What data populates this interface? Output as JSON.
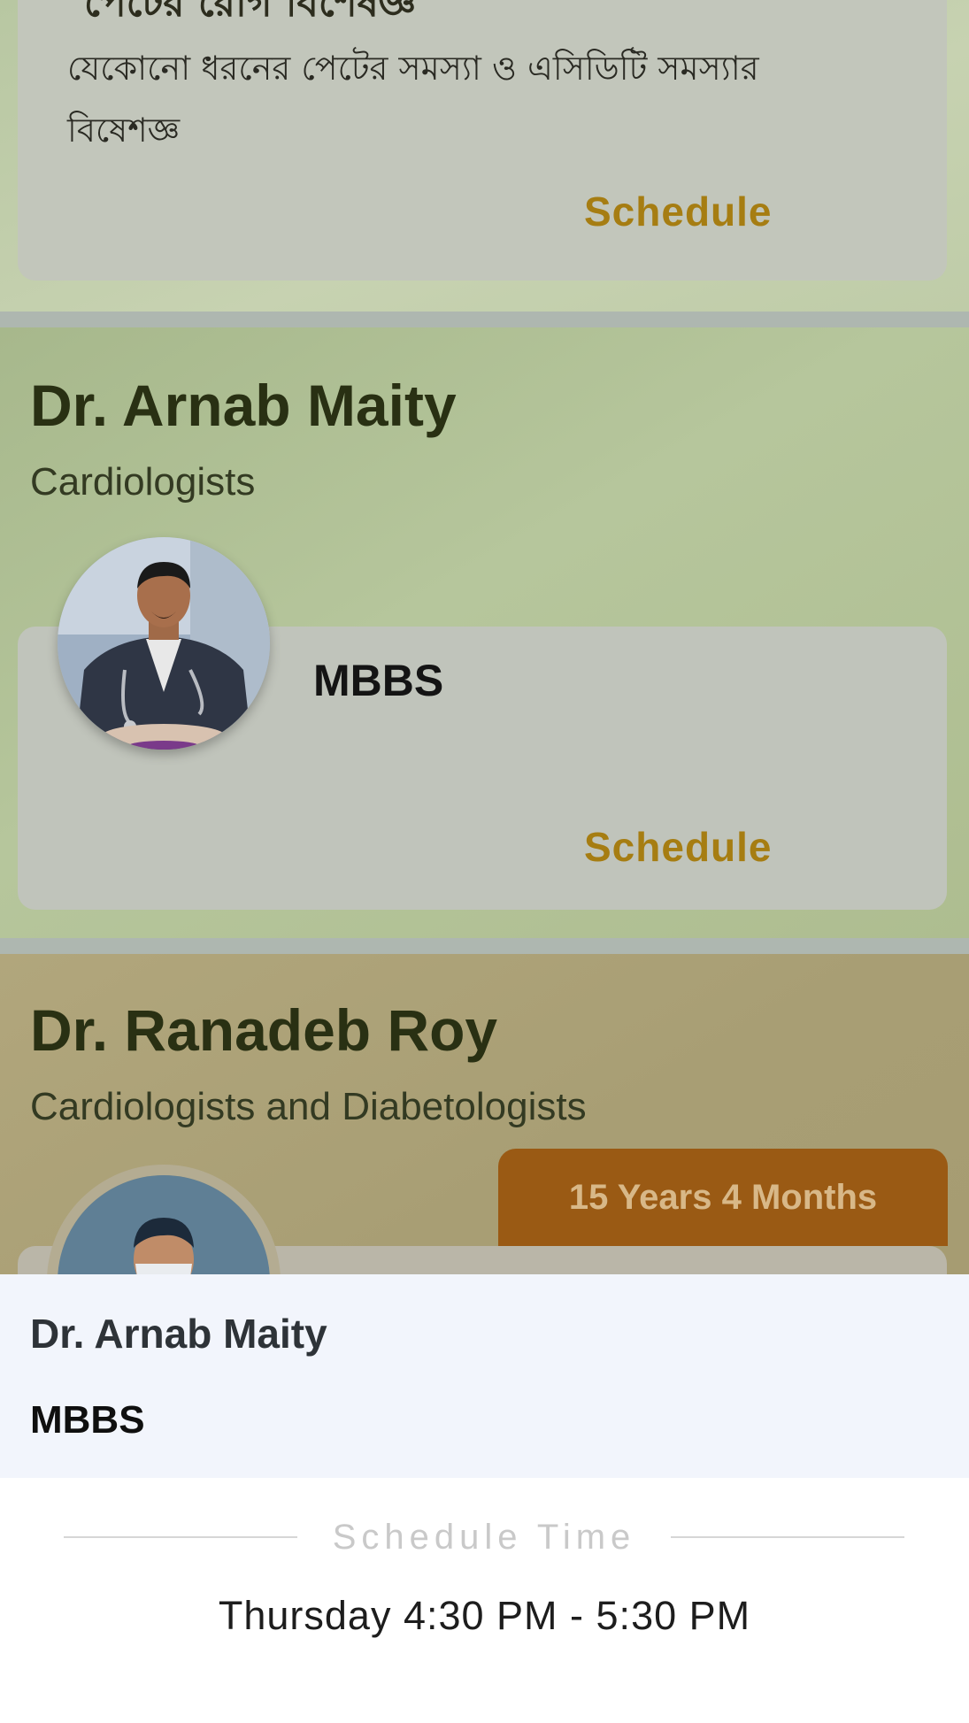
{
  "cards": [
    {
      "heading_partial": "পেটের রোগ বিশেষজ্ঞ",
      "description": "যেকোনো ধরনের পেটের সমস্যা ও এসিডিটি সমস্যার বিষেশজ্ঞ",
      "schedule_label": "Schedule"
    },
    {
      "name": "Dr. Arnab Maity",
      "specialty": "Cardiologists",
      "degree": "MBBS",
      "schedule_label": "Schedule"
    },
    {
      "name": "Dr. Ranadeb Roy",
      "specialty": "Cardiologists and Diabetologists",
      "experience": "15 Years 4 Months"
    }
  ],
  "sheet": {
    "doctor_name": "Dr. Arnab Maity",
    "degree": "MBBS",
    "section_label": "Schedule Time",
    "time": "Thursday 4:30 PM - 5:30 PM"
  },
  "colors": {
    "schedule_accent": "#a67d12",
    "experience_badge": "#9a5a14"
  }
}
